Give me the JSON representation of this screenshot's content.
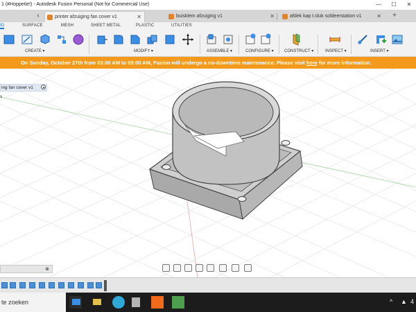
{
  "window": {
    "title": "1 (#Hoppetie!) - Autodesk Fusion Personal (Not for Commercial Use)",
    "minimize": "—",
    "maximize": "☐",
    "close": "✕"
  },
  "doc_tabs": [
    {
      "label": "printer afzuiging fan cover v1",
      "close": "✕"
    },
    {
      "label": "buisklem afzuiging v1",
      "close": "✕"
    },
    {
      "label": "afdek kap t.sluk soldeerstation v1",
      "close": "✕"
    }
  ],
  "tab_add": "+",
  "tab_back": "‹",
  "workspace_tabs": [
    "ID",
    "SURFACE",
    "MESH",
    "SHEET METAL",
    "PLASTIC",
    "UTILITIES"
  ],
  "toolbar_groups": [
    {
      "label": "CREATE ▾"
    },
    {
      "label": "MODIFY ▾"
    },
    {
      "label": "ASSEMBLE ▾"
    },
    {
      "label": "CONFIGURE ▾"
    },
    {
      "label": "CONSTRUCT ▾"
    },
    {
      "label": "INSPECT ▾"
    },
    {
      "label": "INSERT ▾"
    }
  ],
  "banner": {
    "text_before": "On Sunday, October 27th from 03:00 AM to 09:00 AM, Fusion will undergo a no-downtime maintenance. Please visit ",
    "link": "here",
    "text_after": " for more information."
  },
  "browser": {
    "item": "ing fan cover v1",
    "sub": "s"
  },
  "comments": {
    "close": "⊗"
  },
  "taskbar": {
    "search_text": "te zoeken",
    "time": "4"
  },
  "colors": {
    "accent": "#1776d1",
    "banner": "#f39a1d",
    "model_body": "#c9c9c9",
    "model_edge": "#444444",
    "taskbar": "#1c1c1c"
  }
}
